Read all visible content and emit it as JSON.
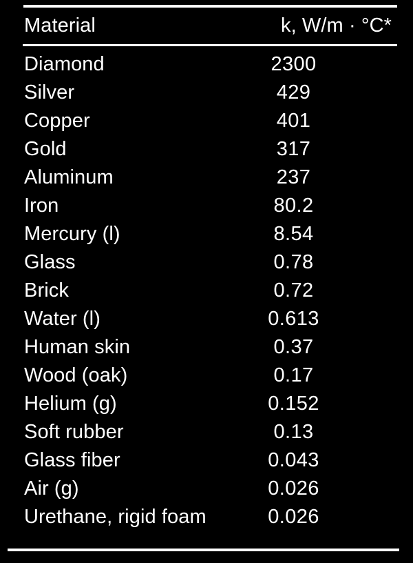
{
  "figure": {
    "kind": "data-table",
    "background_color": "#000000",
    "text_color": "#ffffff"
  },
  "table": {
    "columns": [
      {
        "key": "material",
        "label": "Material",
        "align": "left"
      },
      {
        "key": "k",
        "label": "k, W/m · °C*",
        "align": "right"
      }
    ],
    "rows": [
      {
        "material": "Diamond",
        "k": "2300"
      },
      {
        "material": "Silver",
        "k": "429"
      },
      {
        "material": "Copper",
        "k": "401"
      },
      {
        "material": "Gold",
        "k": "317"
      },
      {
        "material": "Aluminum",
        "k": "237"
      },
      {
        "material": "Iron",
        "k": "80.2"
      },
      {
        "material": "Mercury (l)",
        "k": "8.54"
      },
      {
        "material": "Glass",
        "k": "0.78"
      },
      {
        "material": "Brick",
        "k": "0.72"
      },
      {
        "material": "Water (l)",
        "k": "0.613"
      },
      {
        "material": "Human skin",
        "k": "0.37"
      },
      {
        "material": "Wood (oak)",
        "k": "0.17"
      },
      {
        "material": "Helium (g)",
        "k": "0.152"
      },
      {
        "material": "Soft rubber",
        "k": "0.13"
      },
      {
        "material": "Glass fiber",
        "k": "0.043"
      },
      {
        "material": "Air (g)",
        "k": "0.026"
      },
      {
        "material": "Urethane, rigid foam",
        "k": "0.026"
      }
    ]
  },
  "chart_data": {
    "type": "table",
    "title": "",
    "xlabel": "",
    "ylabel": "",
    "categories": [
      "Diamond",
      "Silver",
      "Copper",
      "Gold",
      "Aluminum",
      "Iron",
      "Mercury (l)",
      "Glass",
      "Brick",
      "Water (l)",
      "Human skin",
      "Wood (oak)",
      "Helium (g)",
      "Soft rubber",
      "Glass fiber",
      "Air (g)",
      "Urethane, rigid foam"
    ],
    "values": [
      2300,
      429,
      401,
      317,
      237,
      80.2,
      8.54,
      0.78,
      0.72,
      0.613,
      0.37,
      0.17,
      0.152,
      0.13,
      0.043,
      0.026,
      0.026
    ],
    "value_labels": [
      "2300",
      "429",
      "401",
      "317",
      "237",
      "80.2",
      "8.54",
      "0.78",
      "0.72",
      "0.613",
      "0.37",
      "0.17",
      "0.152",
      "0.13",
      "0.043",
      "0.026",
      "0.026"
    ],
    "series": [
      {
        "name": "k, W/m · °C*",
        "values": [
          2300,
          429,
          401,
          317,
          237,
          80.2,
          8.54,
          0.78,
          0.72,
          0.613,
          0.37,
          0.17,
          0.152,
          0.13,
          0.043,
          0.026,
          0.026
        ]
      }
    ],
    "column_headers": [
      "Material",
      "k, W/m · °C*"
    ],
    "units": "W/m · °C",
    "grid": false,
    "legend": "none"
  }
}
